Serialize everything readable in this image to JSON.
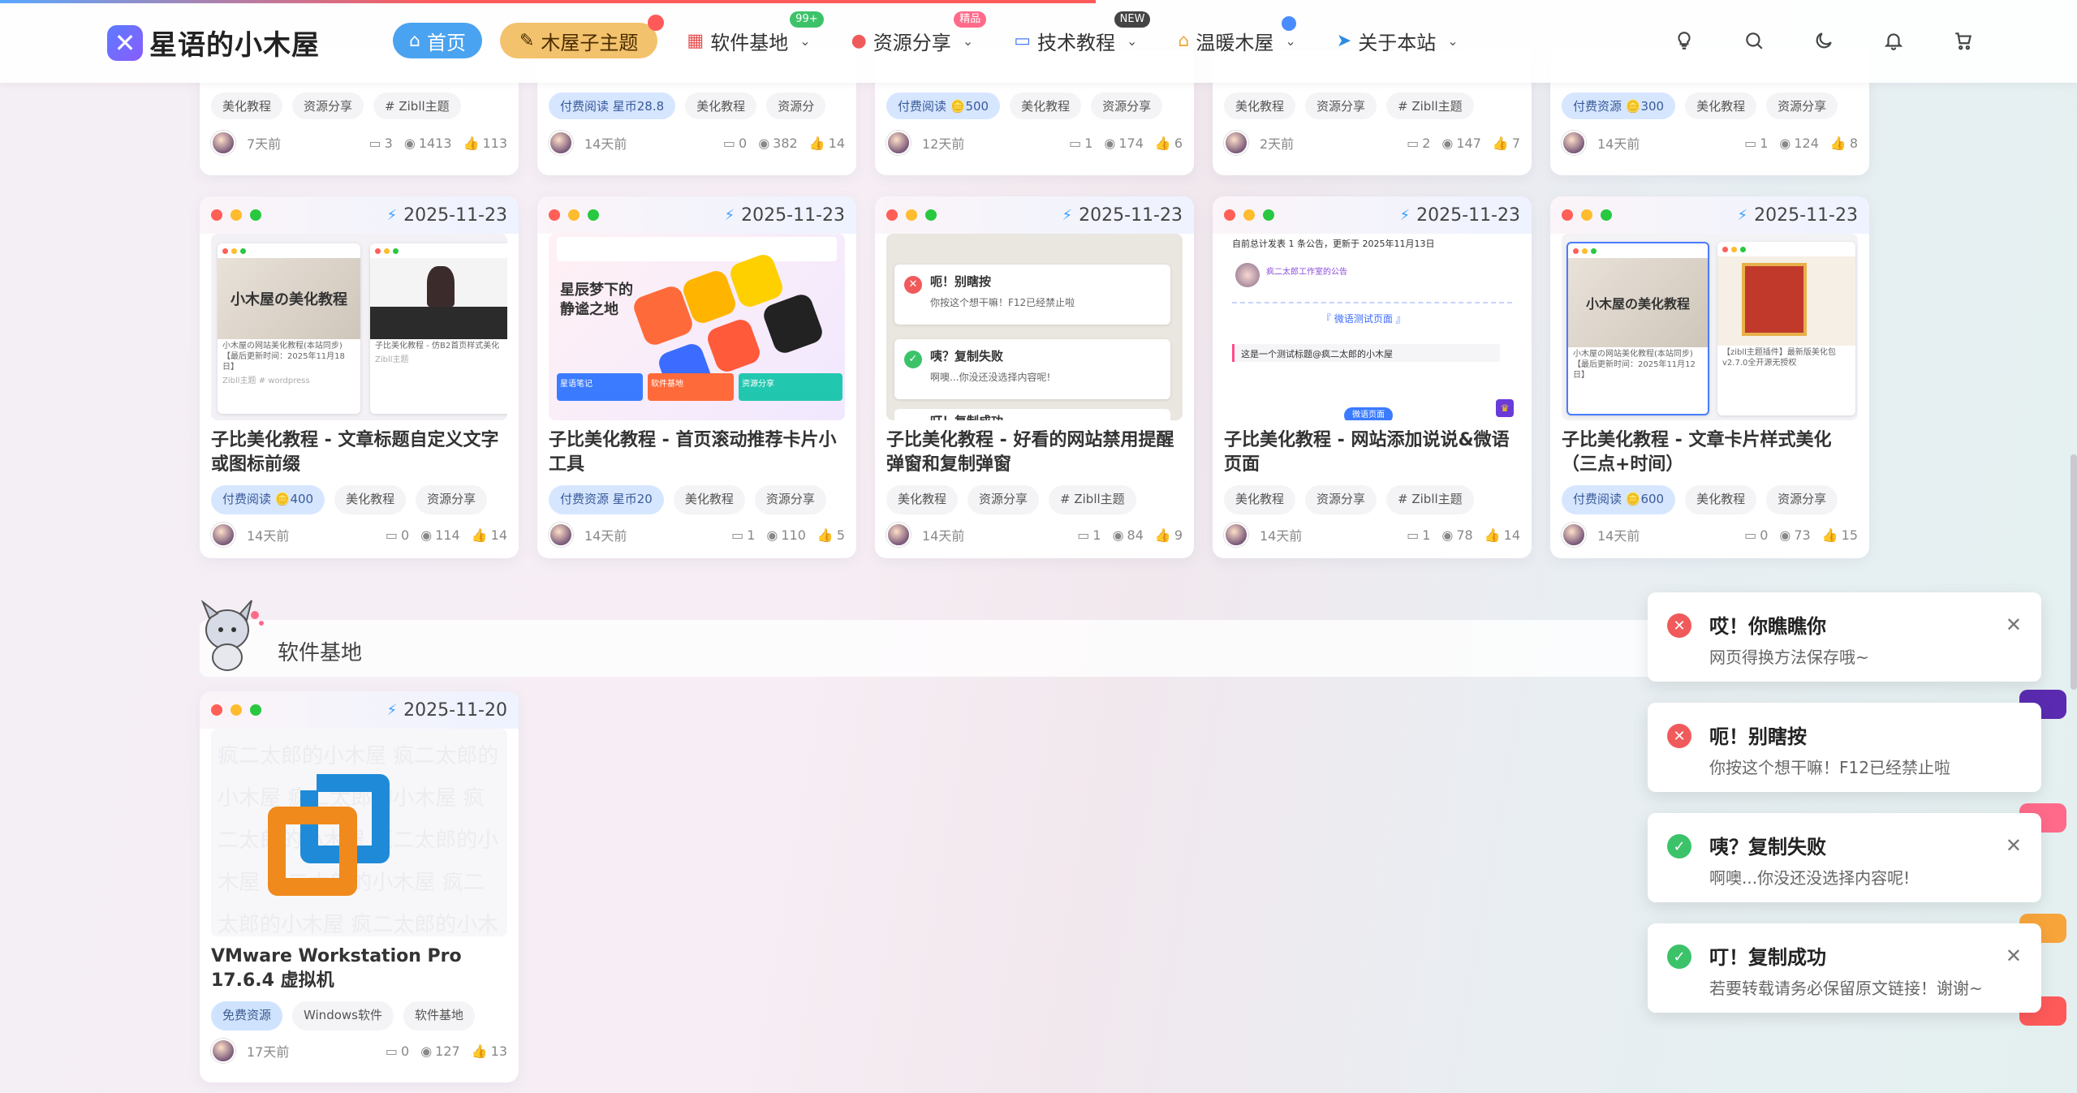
{
  "header": {
    "logo_text": "星语的小木屋",
    "nav": [
      {
        "label": "首页",
        "icon": "home-icon"
      },
      {
        "label": "木屋子主题",
        "icon": "brush-icon",
        "badge": ""
      },
      {
        "label": "软件基地",
        "icon": "grid-icon",
        "badge": "99+"
      },
      {
        "label": "资源分享",
        "icon": "fire-icon",
        "badge": "精品"
      },
      {
        "label": "技术教程",
        "icon": "monitor-icon",
        "badge": "NEW"
      },
      {
        "label": "温暖木屋",
        "icon": "house-icon",
        "badge": ""
      },
      {
        "label": "关于本站",
        "icon": "send-icon",
        "badge": ""
      }
    ]
  },
  "top_row": [
    {
      "tags": [
        "美化教程",
        "资源分享",
        "# Zibll主题"
      ],
      "time": "7天前",
      "comments": "3",
      "views": "1413",
      "likes": "113"
    },
    {
      "tags": [
        "付费阅读 星币28.8",
        "美化教程",
        "资源分"
      ],
      "time": "14天前",
      "comments": "0",
      "views": "382",
      "likes": "14"
    },
    {
      "tags": [
        "付费阅读 🪙500",
        "美化教程",
        "资源分享"
      ],
      "time": "12天前",
      "comments": "1",
      "views": "174",
      "likes": "6"
    },
    {
      "tags": [
        "美化教程",
        "资源分享",
        "# Zibll主题"
      ],
      "time": "2天前",
      "comments": "2",
      "views": "147",
      "likes": "7"
    },
    {
      "tags": [
        "付费资源 🪙300",
        "美化教程",
        "资源分享"
      ],
      "time": "14天前",
      "comments": "1",
      "views": "124",
      "likes": "8"
    }
  ],
  "cards": [
    {
      "date": "2025-11-23",
      "title": "子比美化教程 - 文章标题自定义文字或图标前缀",
      "tags": [
        "付费阅读 🪙400",
        "美化教程",
        "资源分享"
      ],
      "time": "14天前",
      "comments": "0",
      "views": "114",
      "likes": "14",
      "thumb": {
        "a_title": "小木屋の美化教程",
        "a_caption": "小木屋の网站美化教程(本站同步)【最后更新时间：2025年11月18日】",
        "a_tag": "Zibll主题 # wordpress",
        "b_caption": "子比美化教程 - 仿B2首页样式美化",
        "b_tag": "Zibll主题"
      }
    },
    {
      "date": "2025-11-23",
      "title": "子比美化教程 - 首页滚动推荐卡片小工具",
      "tags": [
        "付费资源 星币20",
        "美化教程",
        "资源分享"
      ],
      "time": "14天前",
      "comments": "1",
      "views": "110",
      "likes": "5",
      "thumb": {
        "heading": "星辰梦下的静谧之地",
        "btn1": "星语笔记",
        "btn2": "软件基地",
        "btn3": "资源分享"
      }
    },
    {
      "date": "2025-11-23",
      "title": "子比美化教程 - 好看的网站禁用提醒弹窗和复制弹窗",
      "tags": [
        "美化教程",
        "资源分享",
        "# Zibll主题"
      ],
      "time": "14天前",
      "comments": "1",
      "views": "84",
      "likes": "9",
      "thumb": {
        "t1": "呃！别瞎按",
        "m1": "你按这个想干嘛！F12已经禁止啦",
        "t2": "咦？复制失败",
        "m2": "啊噢...你没还没选择内容呢!",
        "t3": "叮！复制成功"
      }
    },
    {
      "date": "2025-11-23",
      "title": "子比美化教程 - 网站添加说说&微语页面",
      "tags": [
        "美化教程",
        "资源分享",
        "# Zibll主题"
      ],
      "time": "14天前",
      "comments": "1",
      "views": "78",
      "likes": "14",
      "thumb": {
        "top": "自前总计发表 1 条公告，更新于 2025年11月13日",
        "label": "疯二太郎工作室的公告",
        "sub": "『 微语测试页面 』",
        "line": "这是一个测试标题@疯二太郎的小木屋",
        "btn": "微语页面"
      }
    },
    {
      "date": "2025-11-23",
      "title": "子比美化教程 - 文章卡片样式美化（三点+时间）",
      "tags": [
        "付费阅读 🪙600",
        "美化教程",
        "资源分享"
      ],
      "time": "14天前",
      "comments": "0",
      "views": "73",
      "likes": "15",
      "thumb": {
        "a_title": "小木屋の美化教程",
        "a_caption": "小木屋の网站美化教程(本站同步)【最后更新时间：2025年11月12日】",
        "b_caption": "【zibll主题插件】最新版美化包v2.7.0全开源无授权"
      }
    }
  ],
  "section": {
    "title": "软件基地"
  },
  "software_card": {
    "date": "2025-11-20",
    "title": "VMware Workstation Pro 17.6.4 虚拟机",
    "tags": [
      "免费资源",
      "Windows软件",
      "软件基地"
    ],
    "time": "17天前",
    "comments": "0",
    "views": "127",
    "likes": "13",
    "watermark": "疯二太郎的小木屋"
  },
  "toasts": [
    {
      "type": "error",
      "title": "哎！你瞧瞧你",
      "message": "网页得换方法保存哦~"
    },
    {
      "type": "error",
      "title": "呃！别瞎按",
      "message": "你按这个想干嘛！F12已经禁止啦"
    },
    {
      "type": "success",
      "title": "咦？复制失败",
      "message": "啊噢...你没还没选择内容呢!"
    },
    {
      "type": "success",
      "title": "叮！复制成功",
      "message": "若要转载请务必保留原文链接！谢谢~"
    }
  ],
  "colors": {
    "accent": "#4aa3f0",
    "theme_btn": "#f3c26d",
    "error": "#f05a5a",
    "success": "#3cc36a"
  }
}
